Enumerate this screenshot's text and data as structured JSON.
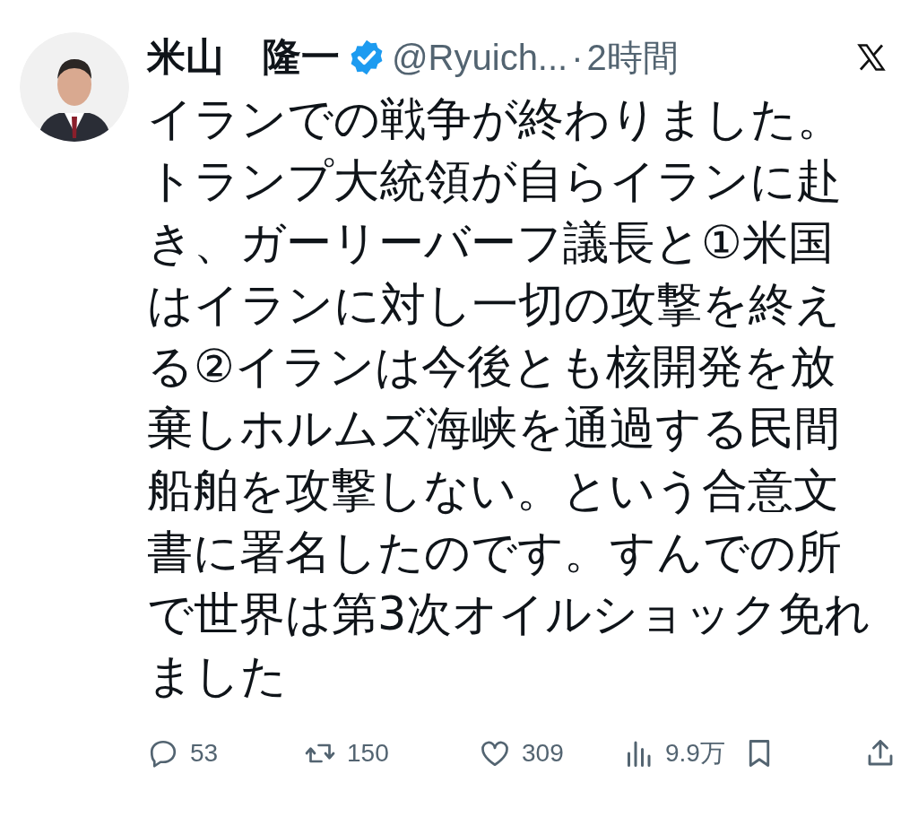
{
  "post": {
    "author_name": "米山　隆一",
    "verified": true,
    "handle": "@Ryuich...",
    "separator": "·",
    "time": "2時間",
    "body": "イランでの戦争が終わりました。トランプ大統領が自らイランに赴き、ガーリーバーフ議長と①米国はイランに対し一切の攻撃を終える②イランは今後とも核開発を放棄しホルムズ海峡を通過する民間船舶を攻撃しない。という合意文書に署名したのです。すんでの所で世界は第3次オイルショック免れました"
  },
  "actions": [
    {
      "kind": "reply",
      "count": "53"
    },
    {
      "kind": "repost",
      "count": "150"
    },
    {
      "kind": "like",
      "count": "309"
    },
    {
      "kind": "views",
      "count": "9.9万"
    },
    {
      "kind": "bookmark"
    },
    {
      "kind": "share"
    }
  ]
}
